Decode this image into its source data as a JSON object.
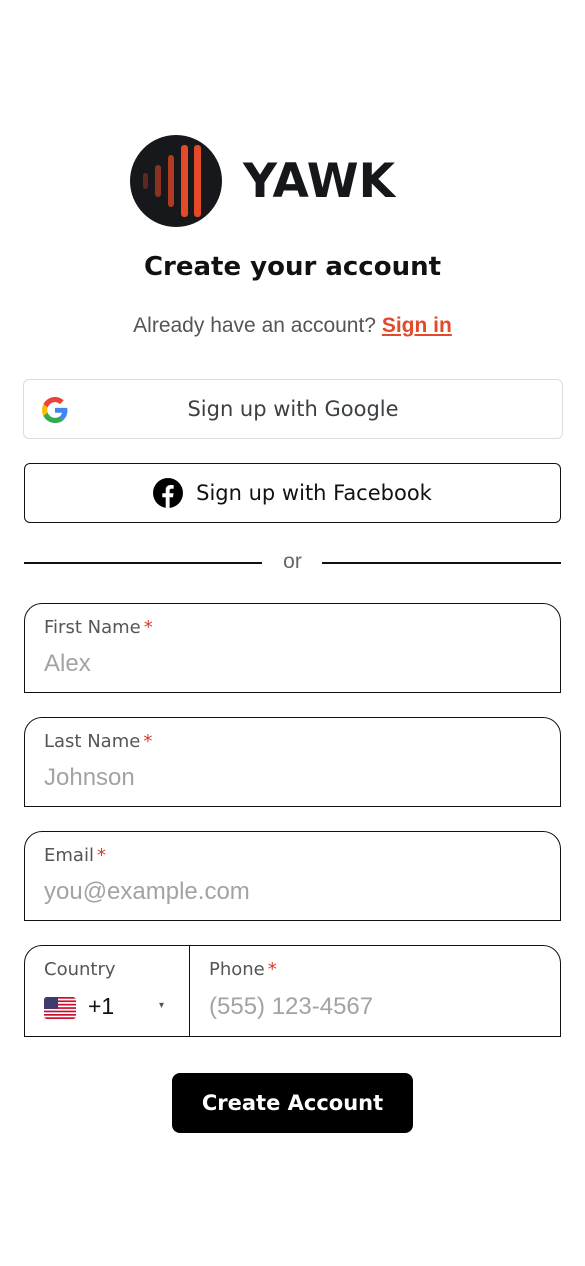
{
  "brand": {
    "name": "YAWK",
    "logo_icon": "sound-bars-logo-icon",
    "accent": "#e44a2a",
    "dark": "#16181b"
  },
  "heading": {
    "title": "Create your account"
  },
  "signin_prompt": {
    "text": "Already have an account?",
    "link": "Sign in"
  },
  "social": {
    "google": {
      "label": "Sign up with Google",
      "icon": "google-icon"
    },
    "facebook": {
      "label": "Sign up with Facebook",
      "icon": "facebook-icon"
    }
  },
  "divider": {
    "text": "or"
  },
  "form": {
    "first_name": {
      "label": "First Name",
      "required_mark": "*",
      "placeholder": "Alex",
      "value": ""
    },
    "last_name": {
      "label": "Last Name",
      "required_mark": "*",
      "placeholder": "Johnson",
      "value": ""
    },
    "email": {
      "label": "Email",
      "required_mark": "*",
      "placeholder": "you@example.com",
      "value": ""
    },
    "country": {
      "label": "Country",
      "flag_icon": "us-flag-icon",
      "code": "+1",
      "caret_icon": "caret-down-icon",
      "caret": "▾"
    },
    "phone": {
      "label": "Phone",
      "required_mark": "*",
      "placeholder": "(555) 123-4567",
      "value": ""
    }
  },
  "actions": {
    "submit_label": "Create Account"
  }
}
